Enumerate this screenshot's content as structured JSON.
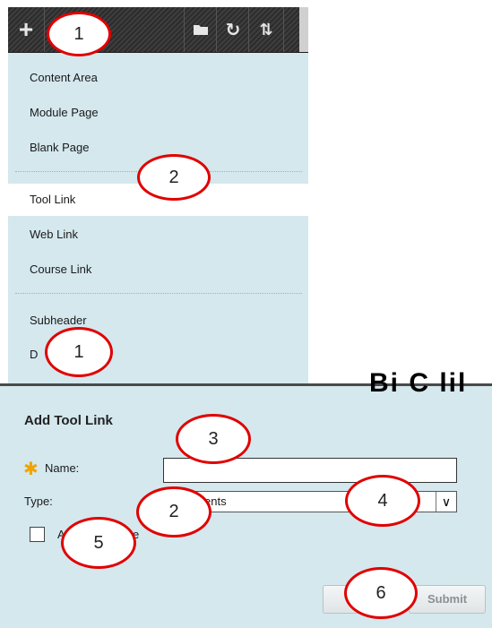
{
  "toolbar": {
    "add_icon": "plus-icon",
    "folder_icon": "folder-icon",
    "refresh_icon": "refresh-icon",
    "sort_icon": "sort-icon"
  },
  "add_menu": {
    "items": [
      {
        "label": "Content Area"
      },
      {
        "label": "Module Page"
      },
      {
        "label": "Blank Page"
      },
      {
        "label": "Tool Link",
        "selected": true
      },
      {
        "label": "Web Link"
      },
      {
        "label": "Course Link"
      },
      {
        "label": "Subheader"
      },
      {
        "label": "D"
      }
    ]
  },
  "background_heading": "Bi  C lil",
  "dialog": {
    "title": "Add Tool Link",
    "required_icon": "asterisk-icon",
    "name_label": "Name:",
    "name_value": "",
    "type_label": "Type:",
    "type_value": "uncements",
    "available_label": "A",
    "available_label_2": "e",
    "cancel_label": "Ca",
    "submit_label": "Submit"
  },
  "annotations": [
    {
      "label": "1"
    },
    {
      "label": "2"
    },
    {
      "label": "1"
    },
    {
      "label": "3"
    },
    {
      "label": "4"
    },
    {
      "label": "2"
    },
    {
      "label": "5"
    },
    {
      "label": "6"
    }
  ],
  "colors": {
    "panel_bg": "#d4e8ee",
    "toolbar_bg": "#333333",
    "annotation_ring": "#e00000",
    "required_star": "#f0a400"
  }
}
